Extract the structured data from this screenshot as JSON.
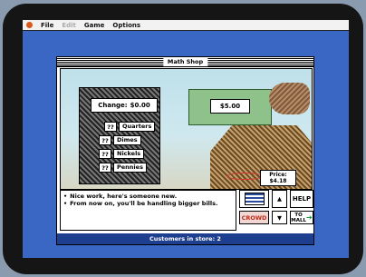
{
  "menubar": {
    "items": [
      "File",
      "Edit",
      "Game",
      "Options"
    ]
  },
  "window": {
    "title": "Math Shop"
  },
  "register": {
    "change_label": "Change:",
    "change_value": "$0.00",
    "coins": [
      {
        "qty": "??",
        "label": "Quarters"
      },
      {
        "qty": "??",
        "label": "Dimes"
      },
      {
        "qty": "??",
        "label": "Nickels"
      },
      {
        "qty": "??",
        "label": "Pennies"
      }
    ]
  },
  "bill": {
    "value": "$5.00"
  },
  "price": {
    "label": "Price:",
    "value": "$4.18"
  },
  "messages": [
    "Nice work, here's someone new.",
    "From now on, you'll be handling bigger bills."
  ],
  "controls": {
    "crowd": "CROWD",
    "help": "HELP",
    "mall_line1": "TO",
    "mall_line2": "MALL"
  },
  "status": "Customers in store: 2",
  "colors": {
    "screen": "#3a67c4",
    "status_bar": "#1e3f90",
    "bill": "#8fc28a"
  }
}
